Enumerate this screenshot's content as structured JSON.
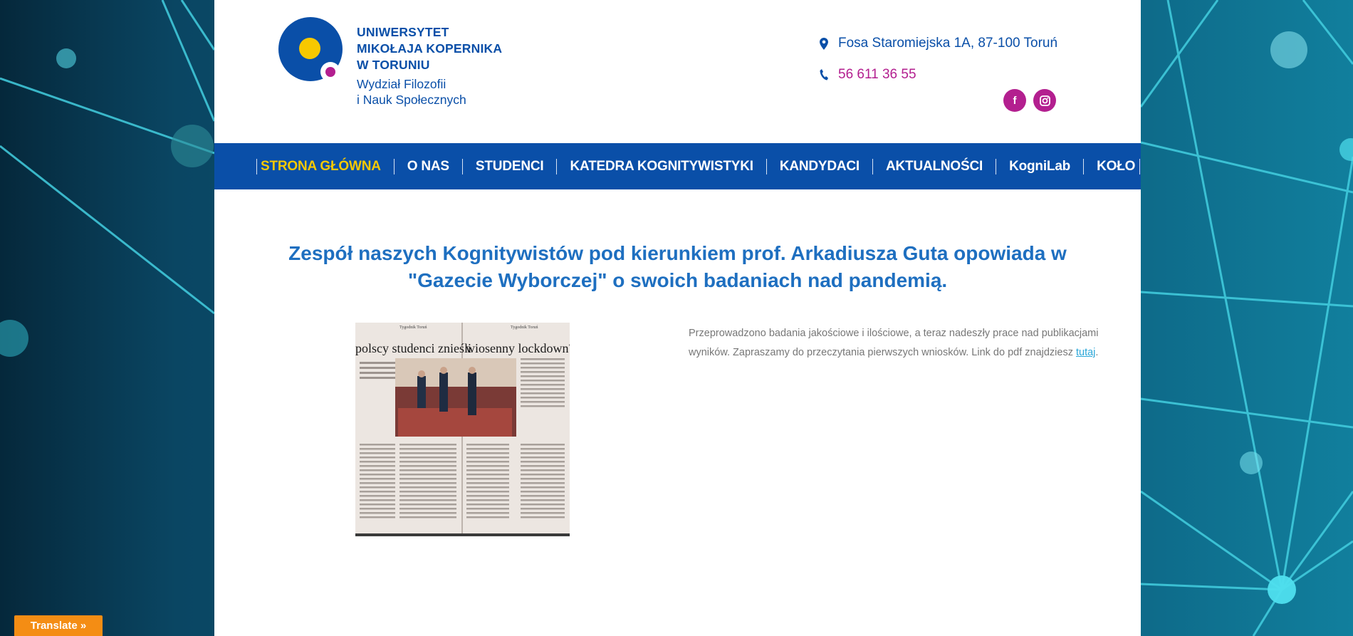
{
  "header": {
    "university_name": [
      "UNIWERSYTET",
      "MIKOŁAJA KOPERNIKA",
      "W TORUNIU"
    ],
    "department": [
      "Wydział Filozofii",
      "i Nauk Społecznych"
    ],
    "address": "Fosa Staromiejska 1A, 87-100 Toruń",
    "phone": "56 611 36 55",
    "social": [
      {
        "name": "facebook",
        "glyph": "f"
      },
      {
        "name": "instagram",
        "glyph": "instagram-icon"
      }
    ]
  },
  "nav": {
    "items": [
      {
        "label": "STRONA GŁÓWNA",
        "active": true
      },
      {
        "label": "O NAS",
        "active": false
      },
      {
        "label": "STUDENCI",
        "active": false
      },
      {
        "label": "KATEDRA KOGNITYWISTYKI",
        "active": false
      },
      {
        "label": "KANDYDACI",
        "active": false
      },
      {
        "label": "AKTUALNOŚCI",
        "active": false
      },
      {
        "label": "KogniLab",
        "active": false
      },
      {
        "label": "KOŁO",
        "active": false
      }
    ]
  },
  "article": {
    "title": "Zespół naszych Kognitywistów pod kierunkiem prof. Arkadiusza Guta opowiada w \"Gazecie Wyborczej\" o swoich badaniach nad pandemią.",
    "image_headline_left": "polscy studenci znieśli",
    "image_headline_right": "wiosenny lockdown?",
    "image_masthead_left": "Tygodnik Toruń",
    "image_masthead_right": "Tygodnik Toruń",
    "body_text": "Przeprowadzono badania jakościowe i ilościowe, a teraz nadeszły prace nad publikacjami wyników. Zapraszamy do przeczytania pierwszych wniosków. Link do pdf znajdziesz ",
    "link_text": "tutaj",
    "trailing": "."
  },
  "translate": {
    "label": "Translate »"
  },
  "colors": {
    "brand_blue": "#0a4fa8",
    "accent_magenta": "#b31f8f",
    "accent_yellow": "#f7c800",
    "title_blue": "#1e6fc0",
    "translate_orange": "#f48d14"
  }
}
